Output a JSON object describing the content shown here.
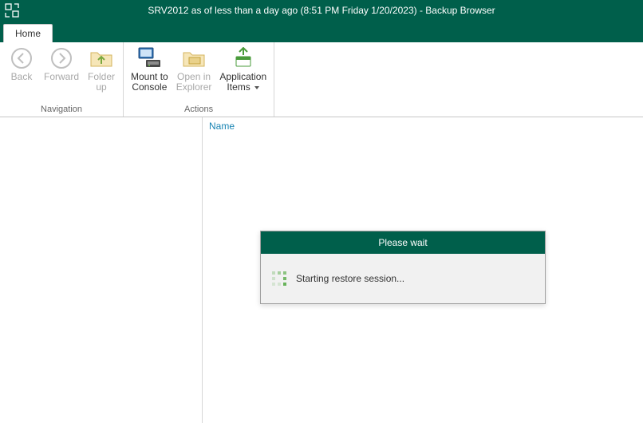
{
  "window": {
    "title": "SRV2012 as of less than a day ago (8:51 PM Friday 1/20/2023) - Backup Browser"
  },
  "tabs": {
    "home": "Home"
  },
  "ribbon": {
    "navigation": {
      "label": "Navigation",
      "back": "Back",
      "forward": "Forward",
      "folder_up": "Folder\nup"
    },
    "actions": {
      "label": "Actions",
      "mount_to_console": "Mount to\nConsole",
      "open_in_explorer": "Open in\nExplorer",
      "application_items": "Application\nItems"
    }
  },
  "list": {
    "header_name": "Name"
  },
  "dialog": {
    "title": "Please wait",
    "message": "Starting restore session..."
  }
}
